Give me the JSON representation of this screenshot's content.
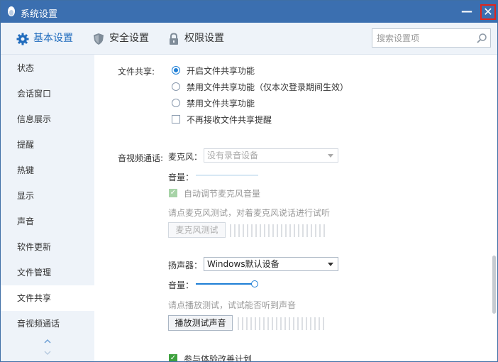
{
  "window": {
    "title": "系统设置",
    "min_label": "—",
    "close_label": "✕"
  },
  "toolbar": {
    "tabs": [
      {
        "label": "基本设置",
        "icon": "gear-icon",
        "active": true
      },
      {
        "label": "安全设置",
        "icon": "shield-icon",
        "active": false
      },
      {
        "label": "权限设置",
        "icon": "lock-icon",
        "active": false
      }
    ],
    "search_placeholder": "搜索设置项"
  },
  "sidebar": {
    "items": [
      {
        "label": "状态"
      },
      {
        "label": "会话窗口"
      },
      {
        "label": "信息展示"
      },
      {
        "label": "提醒"
      },
      {
        "label": "热键"
      },
      {
        "label": "显示"
      },
      {
        "label": "声音"
      },
      {
        "label": "软件更新"
      },
      {
        "label": "文件管理"
      },
      {
        "label": "文件共享",
        "active": true
      },
      {
        "label": "音视频通话"
      }
    ]
  },
  "file_share": {
    "label": "文件共享:",
    "options": [
      {
        "label": "开启文件共享功能",
        "selected": true
      },
      {
        "label": "禁用文件共享功能（仅本次登录期间生效）",
        "selected": false
      },
      {
        "label": "禁用文件共享功能",
        "selected": false
      }
    ],
    "no_remind_label": "不再接收文件共享提醒",
    "no_remind_checked": false
  },
  "av_call": {
    "label": "音视频通话:",
    "mic": {
      "label": "麦克风：",
      "device": "没有录音设备",
      "volume_label": "音量：",
      "auto_adjust_label": "自动调节麦克风音量",
      "auto_adjust_checked": true,
      "hint": "请点麦克风测试，对着麦克风说话进行试听",
      "test_button": "麦克风测试"
    },
    "speaker": {
      "label": "扬声器：",
      "device": "Windows默认设备",
      "volume_label": "音量：",
      "volume_level": 1.0,
      "hint": "请点播放测试，试试能否听到声音",
      "test_button": "播放测试声音"
    },
    "improve_label": "参与体验改善计划",
    "improve_checked": true
  }
}
